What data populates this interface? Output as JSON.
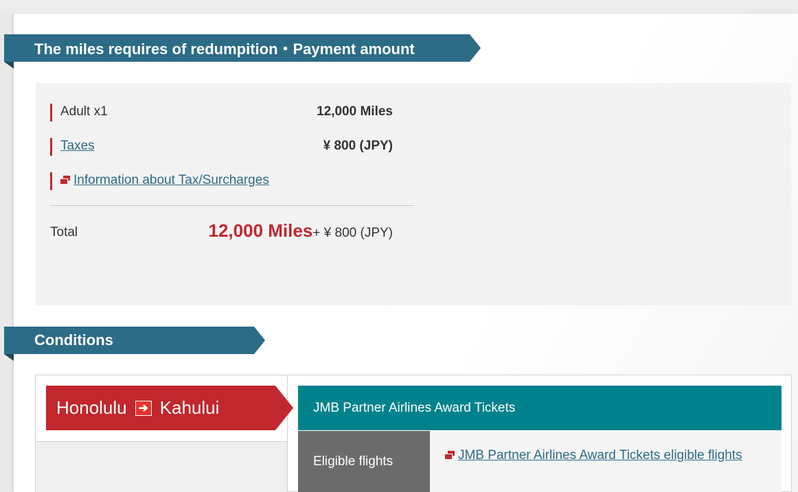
{
  "sections": {
    "payment_title": "The miles requires of redumpition・Payment amount",
    "conditions_title": "Conditions"
  },
  "payment": {
    "adult_label": "Adult x1",
    "adult_value": "12,000 Miles",
    "taxes_label": "Taxes",
    "taxes_value": "¥ 800 (JPY)",
    "info_link": "Information about Tax/Surcharges",
    "total_label": "Total",
    "total_miles": "12,000 Miles",
    "total_tax": "+ ¥ 800 (JPY)"
  },
  "conditions": {
    "origin": "Honolulu",
    "arrow": "➔",
    "destination": "Kahului",
    "award_type": "JMB Partner Airlines Award Tickets",
    "eligible_label": "Eligible flights",
    "eligible_link": "JMB Partner Airlines Award Tickets eligible flights"
  },
  "colors": {
    "banner": "#2c6c86",
    "accent_red": "#c1272d",
    "teal": "#00828c",
    "gray_label": "#6b6b6b"
  },
  "icons": [
    "external-link-icon",
    "route-arrow-icon"
  ]
}
